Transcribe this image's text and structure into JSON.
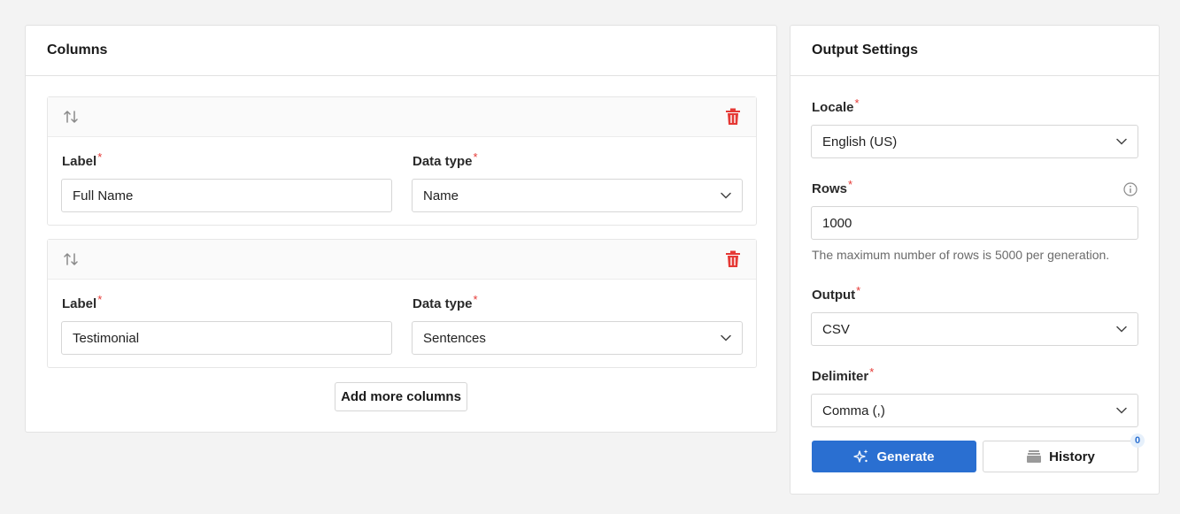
{
  "columns_panel": {
    "title": "Columns",
    "add_more_label": "Add more columns",
    "columns": [
      {
        "label_caption": "Label",
        "label_value": "Full Name",
        "type_caption": "Data type",
        "type_value": "Name"
      },
      {
        "label_caption": "Label",
        "label_value": "Testimonial",
        "type_caption": "Data type",
        "type_value": "Sentences"
      }
    ]
  },
  "settings_panel": {
    "title": "Output Settings",
    "locale": {
      "label": "Locale",
      "value": "English (US)"
    },
    "rows": {
      "label": "Rows",
      "value": "1000",
      "hint": "The maximum number of rows is 5000 per generation."
    },
    "output": {
      "label": "Output",
      "value": "CSV"
    },
    "delimiter": {
      "label": "Delimiter",
      "value": "Comma (,)"
    },
    "generate_label": "Generate",
    "history_label": "History",
    "history_count": "0"
  },
  "required_marker": "*",
  "icons": {
    "sort": "sort-arrows-icon",
    "delete": "trash-icon",
    "dropdown": "chevron-down-icon",
    "info": "info-icon",
    "generate": "sparkle-icon",
    "history": "archive-icon"
  },
  "colors": {
    "accent": "#2a6fd1",
    "danger": "#e53935",
    "required": "#e53935",
    "background": "#f3f3f3"
  }
}
